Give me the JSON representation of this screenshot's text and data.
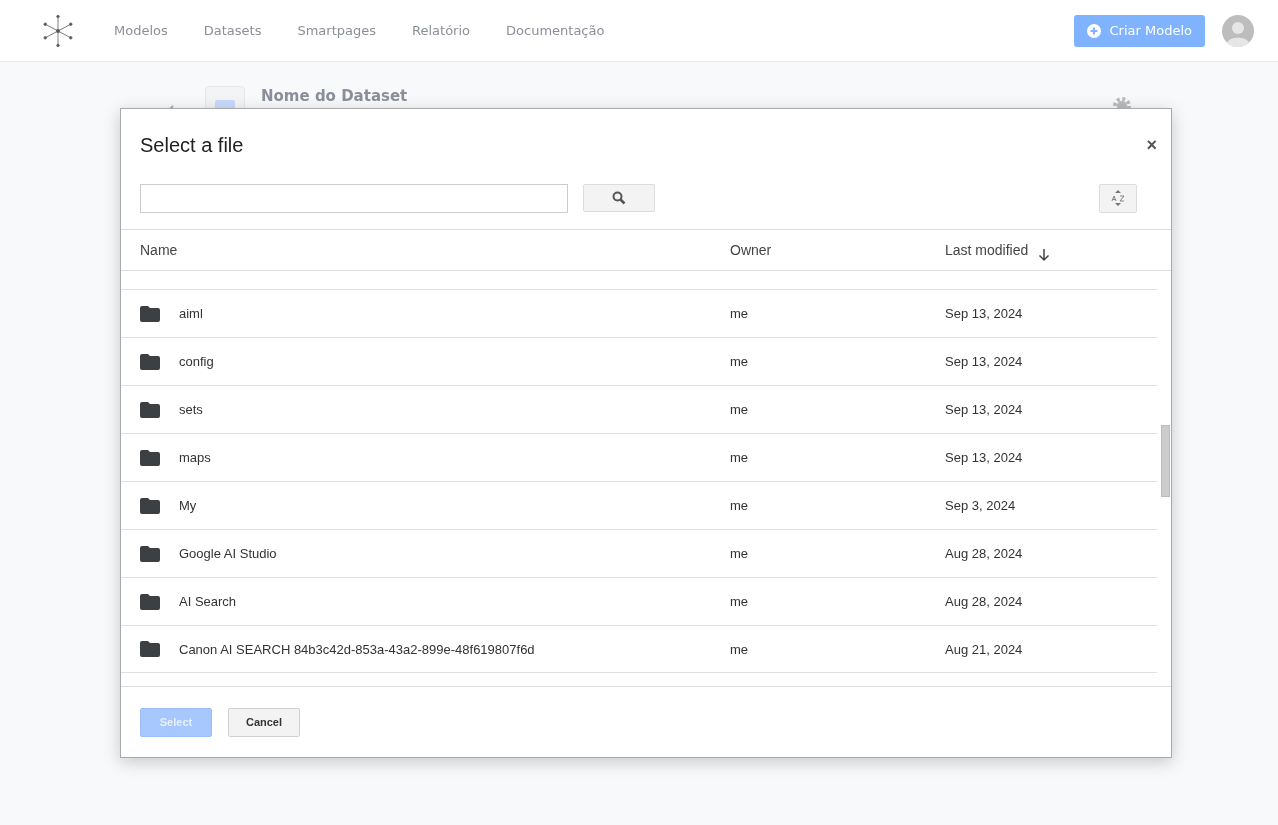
{
  "header": {
    "nav": [
      "Modelos",
      "Datasets",
      "Smartpages",
      "Relatório",
      "Documentação"
    ],
    "create_button": "Criar Modelo"
  },
  "page": {
    "dataset_title": "Nome do Dataset"
  },
  "dialog": {
    "title": "Select a file",
    "close": "×",
    "columns": [
      {
        "label": "Name"
      },
      {
        "label": "Owner"
      },
      {
        "label": "Last modified",
        "sorted": true
      }
    ],
    "rows": [
      {
        "name": "aiml",
        "owner": "me",
        "modified": "Sep 13, 2024"
      },
      {
        "name": "config",
        "owner": "me",
        "modified": "Sep 13, 2024"
      },
      {
        "name": "sets",
        "owner": "me",
        "modified": "Sep 13, 2024"
      },
      {
        "name": "maps",
        "owner": "me",
        "modified": "Sep 13, 2024"
      },
      {
        "name": "My",
        "owner": "me",
        "modified": "Sep 3, 2024"
      },
      {
        "name": "Google AI Studio",
        "owner": "me",
        "modified": "Aug 28, 2024"
      },
      {
        "name": "AI Search",
        "owner": "me",
        "modified": "Aug 28, 2024"
      },
      {
        "name": "Canon AI SEARCH 84b3c42d-853a-43a2-899e-48f619807f6d",
        "owner": "me",
        "modified": "Aug 21, 2024"
      }
    ],
    "buttons": [
      {
        "label": "Select",
        "disabled": true
      },
      {
        "label": "Cancel",
        "disabled": false
      }
    ]
  }
}
